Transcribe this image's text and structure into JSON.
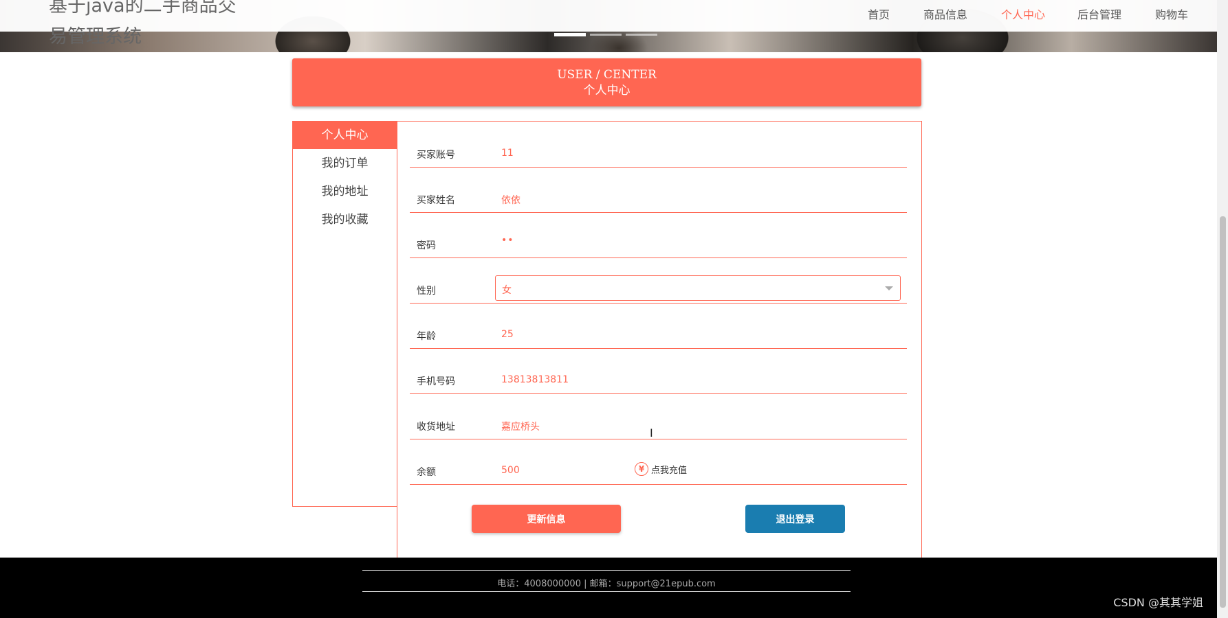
{
  "site": {
    "title": "基于java的二手商品交易管理系统"
  },
  "nav": {
    "items": [
      {
        "label": "首页",
        "active": false
      },
      {
        "label": "商品信息",
        "active": false
      },
      {
        "label": "个人中心",
        "active": true
      },
      {
        "label": "后台管理",
        "active": false
      },
      {
        "label": "购物车",
        "active": false
      }
    ],
    "carousel_dots": 3,
    "active_dot": 0
  },
  "header": {
    "en": "USER / CENTER",
    "cn": "个人中心"
  },
  "side_menu": {
    "items": [
      {
        "label": "个人中心",
        "active": true
      },
      {
        "label": "我的订单",
        "active": false
      },
      {
        "label": "我的地址",
        "active": false
      },
      {
        "label": "我的收藏",
        "active": false
      }
    ]
  },
  "form": {
    "account": {
      "label": "买家账号",
      "value": "11"
    },
    "name": {
      "label": "买家姓名",
      "value": "依依"
    },
    "password": {
      "label": "密码",
      "value": "••"
    },
    "gender": {
      "label": "性别",
      "value": "女"
    },
    "age": {
      "label": "年龄",
      "value": "25"
    },
    "phone": {
      "label": "手机号码",
      "value": "13813813811"
    },
    "address": {
      "label": "收货地址",
      "value": "嘉应桥头"
    },
    "balance": {
      "label": "余额",
      "value": "500",
      "recharge_label": "点我充值",
      "recharge_icon": "¥"
    }
  },
  "buttons": {
    "update": "更新信息",
    "logout": "退出登录"
  },
  "footer": {
    "contact": "电话：4008000000 | 邮箱：support@21epub.com"
  },
  "watermark": "CSDN @其其学姐",
  "colors": {
    "accent": "#ff6652",
    "logout": "#1a7db0",
    "footer_bg": "#000000"
  }
}
